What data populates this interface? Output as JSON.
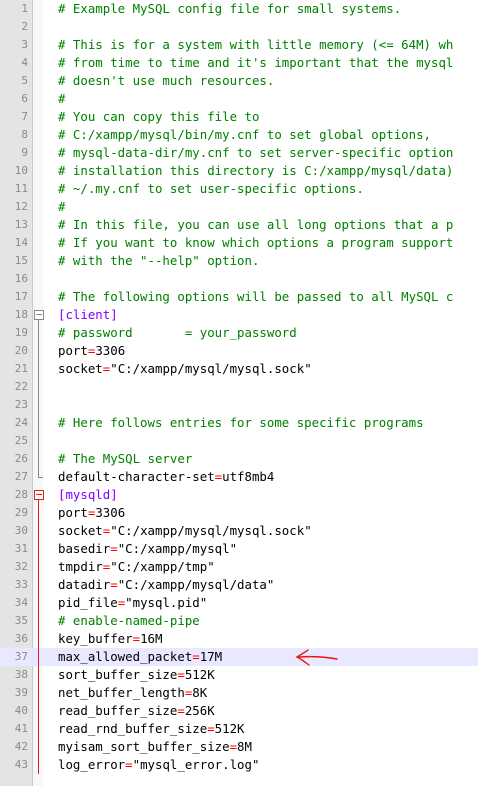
{
  "colors": {
    "comment": "#008000",
    "section": "#8000ff",
    "key": "#000000",
    "operator": "#ff0000",
    "gutter_bg": "#e4e4e4",
    "current_line_bg": "#e8e8ff",
    "fold_marker": "#dd2222",
    "annotation_arrow": "#ee1111"
  },
  "annotation": {
    "icon": "red-arrow-pointing-left"
  },
  "lines": [
    {
      "n": "1",
      "comment": "# Example MySQL config file for small systems."
    },
    {
      "n": "2"
    },
    {
      "n": "3",
      "comment": "# This is for a system with little memory (<= 64M) wh"
    },
    {
      "n": "4",
      "comment": "# from time to time and it's important that the mysql"
    },
    {
      "n": "5",
      "comment": "# doesn't use much resources."
    },
    {
      "n": "6",
      "comment": "#"
    },
    {
      "n": "7",
      "comment": "# You can copy this file to"
    },
    {
      "n": "8",
      "comment": "# C:/xampp/mysql/bin/my.cnf to set global options,"
    },
    {
      "n": "9",
      "comment": "# mysql-data-dir/my.cnf to set server-specific option"
    },
    {
      "n": "10",
      "comment": "# installation this directory is C:/xampp/mysql/data)"
    },
    {
      "n": "11",
      "comment": "# ~/.my.cnf to set user-specific options."
    },
    {
      "n": "12",
      "comment": "#"
    },
    {
      "n": "13",
      "comment": "# In this file, you can use all long options that a p"
    },
    {
      "n": "14",
      "comment": "# If you want to know which options a program support"
    },
    {
      "n": "15",
      "comment": "# with the \"--help\" option."
    },
    {
      "n": "16"
    },
    {
      "n": "17",
      "comment": "# The following options will be passed to all MySQL c"
    },
    {
      "n": "18",
      "section": "[client]"
    },
    {
      "n": "19",
      "comment": "# password       = your_password"
    },
    {
      "n": "20",
      "key": "port",
      "value": "3306"
    },
    {
      "n": "21",
      "key": "socket",
      "value": "\"C:/xampp/mysql/mysql.sock\""
    },
    {
      "n": "22"
    },
    {
      "n": "23"
    },
    {
      "n": "24",
      "comment": "# Here follows entries for some specific programs"
    },
    {
      "n": "25"
    },
    {
      "n": "26",
      "comment": "# The MySQL server"
    },
    {
      "n": "27",
      "key": "default-character-set",
      "value": "utf8mb4"
    },
    {
      "n": "28",
      "section": "[mysqld]"
    },
    {
      "n": "29",
      "key": "port",
      "value": "3306"
    },
    {
      "n": "30",
      "key": "socket",
      "value": "\"C:/xampp/mysql/mysql.sock\""
    },
    {
      "n": "31",
      "key": "basedir",
      "value": "\"C:/xampp/mysql\""
    },
    {
      "n": "32",
      "key": "tmpdir",
      "value": "\"C:/xampp/tmp\""
    },
    {
      "n": "33",
      "key": "datadir",
      "value": "\"C:/xampp/mysql/data\""
    },
    {
      "n": "34",
      "key": "pid_file",
      "value": "\"mysql.pid\""
    },
    {
      "n": "35",
      "comment": "# enable-named-pipe"
    },
    {
      "n": "36",
      "key": "key_buffer",
      "value": "16M"
    },
    {
      "n": "37",
      "key": "max_allowed_packet",
      "value": "17M",
      "highlight": true
    },
    {
      "n": "38",
      "key": "sort_buffer_size",
      "value": "512K"
    },
    {
      "n": "39",
      "key": "net_buffer_length",
      "value": "8K"
    },
    {
      "n": "40",
      "key": "read_buffer_size",
      "value": "256K"
    },
    {
      "n": "41",
      "key": "read_rnd_buffer_size",
      "value": "512K"
    },
    {
      "n": "42",
      "key": "myisam_sort_buffer_size",
      "value": "8M"
    },
    {
      "n": "43",
      "key": "log_error",
      "value": "\"mysql_error.log\""
    }
  ]
}
